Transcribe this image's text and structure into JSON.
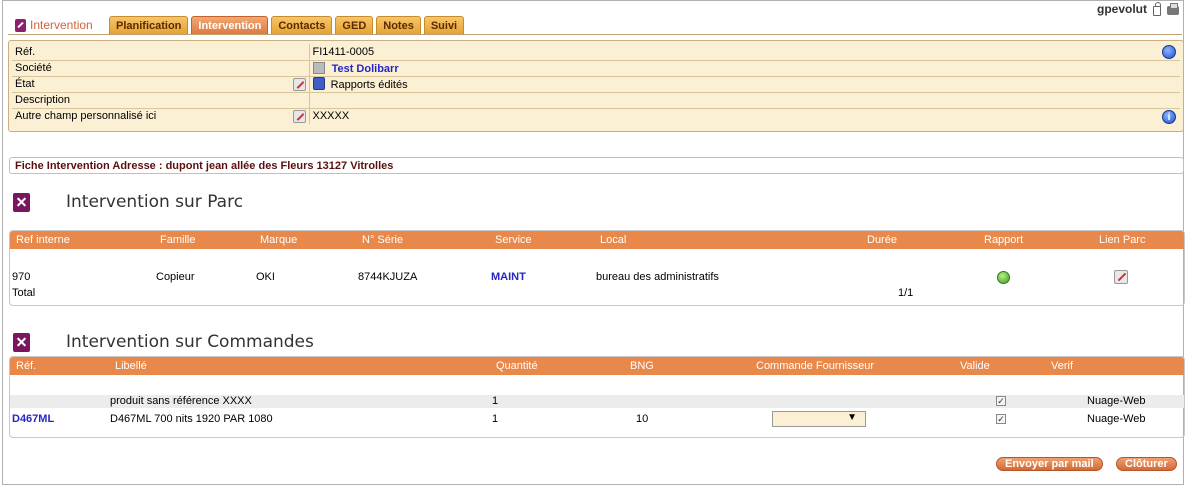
{
  "header": {
    "app_title": "Intervention",
    "tabs": [
      "Planification",
      "Intervention",
      "Contacts",
      "GED",
      "Notes",
      "Suivi"
    ],
    "active_tab": "Intervention",
    "user": "gpevolut"
  },
  "info": {
    "ref_label": "Réf.",
    "ref_value": "FI1411-0005",
    "societe_label": "Société",
    "societe_value": "Test Dolibarr",
    "etat_label": "État",
    "etat_value": "Rapports édités",
    "description_label": "Description",
    "description_value": "",
    "custom_label": "Autre champ personnalisé ici",
    "custom_value": "XXXXX"
  },
  "address": "Fiche Intervention Adresse : dupont jean allée des Fleurs 13127 Vitrolles",
  "parc": {
    "title": "Intervention sur Parc",
    "headers": [
      "Ref interne",
      "Famille",
      "Marque",
      "N° Série",
      "Service",
      "Local",
      "Durée",
      "Rapport",
      "Lien Parc"
    ],
    "row": {
      "ref": "970",
      "famille": "Copieur",
      "marque": "OKI",
      "serie": "8744KJUZA",
      "service": "MAINT",
      "local": "bureau des administratifs"
    },
    "total_label": "Total",
    "total_duree": "1/1"
  },
  "commandes": {
    "title": "Intervention sur Commandes",
    "headers": [
      "Réf.",
      "Libellé",
      "Quantité",
      "BNG",
      "Commande Fournisseur",
      "Valide",
      "Verif"
    ],
    "rows": [
      {
        "ref": "",
        "libelle": "produit sans référence XXXX",
        "quantite": "1",
        "bng": "",
        "valide": true,
        "verif": "Nuage-Web"
      },
      {
        "ref": "D467ML",
        "libelle": "D467ML  700 nits 1920 PAR 1080",
        "quantite": "1",
        "bng": "10",
        "valide": true,
        "verif": "Nuage-Web"
      }
    ],
    "select_value": ""
  },
  "buttons": {
    "send_mail": "Envoyer par mail",
    "close": "Clôturer"
  },
  "colors": {
    "accent_orange": "#e8884a",
    "info_bg": "#fbf0d4",
    "link_blue": "#2626c4"
  }
}
